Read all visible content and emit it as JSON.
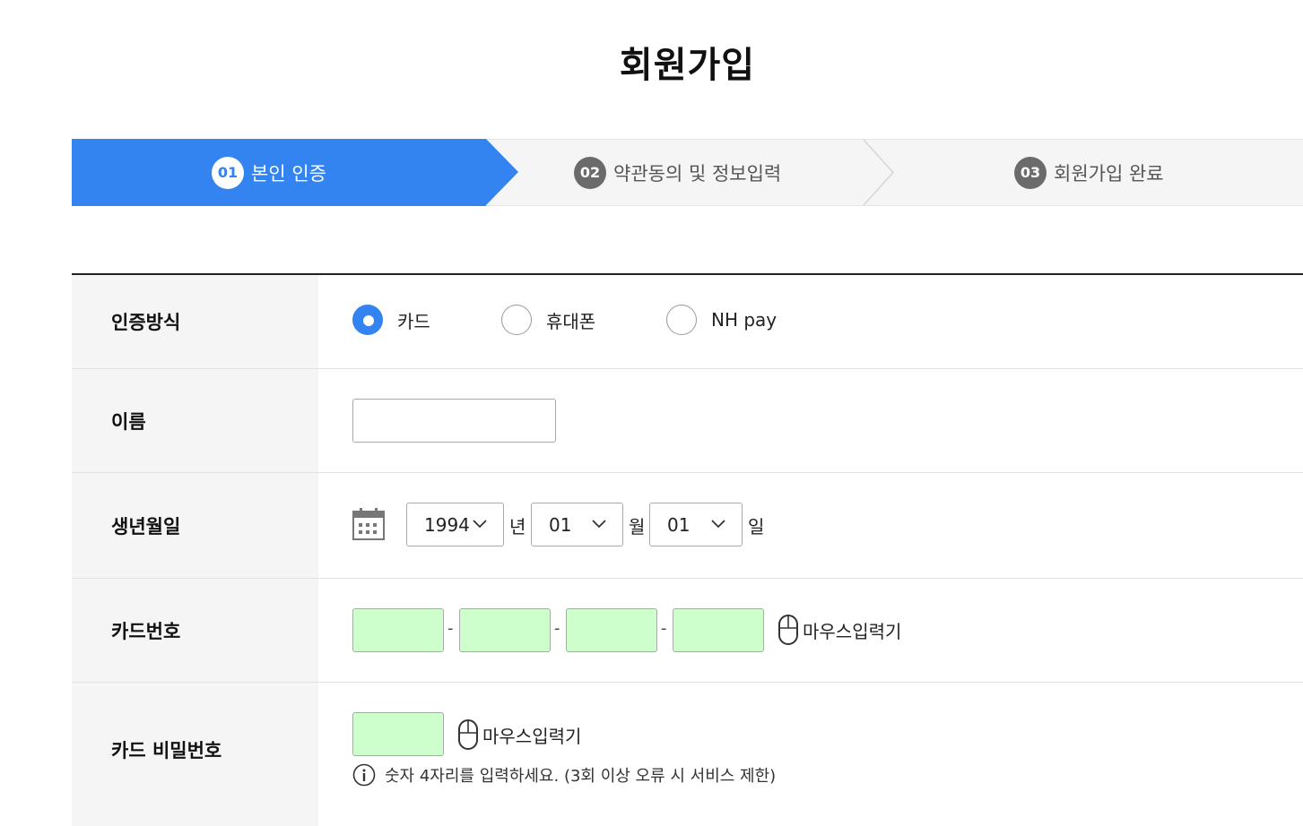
{
  "page": {
    "title": "회원가입"
  },
  "steps": [
    {
      "num": "01",
      "label": "본인 인증",
      "active": true
    },
    {
      "num": "02",
      "label": "약관동의 및 정보입력",
      "active": false
    },
    {
      "num": "03",
      "label": "회원가입 완료",
      "active": false
    }
  ],
  "form": {
    "auth_method": {
      "label": "인증방식",
      "options": [
        "카드",
        "휴대폰",
        "NH pay"
      ],
      "selected": "카드"
    },
    "name": {
      "label": "이름",
      "value": ""
    },
    "birth": {
      "label": "생년월일",
      "year": "1994",
      "year_unit": "년",
      "month": "01",
      "month_unit": "월",
      "day": "01",
      "day_unit": "일"
    },
    "card_number": {
      "label": "카드번호",
      "separator": "-",
      "mouse_input_label": "마우스입력기"
    },
    "card_password": {
      "label": "카드 비밀번호",
      "mouse_input_label": "마우스입력기",
      "notice": "숫자 4자리를 입력하세요. (3회 이상 오류 시 서비스 제한)"
    }
  },
  "colors": {
    "accent": "#3384f0",
    "input_green": "#ccffcc",
    "step_bg": "#f5f5f5"
  }
}
